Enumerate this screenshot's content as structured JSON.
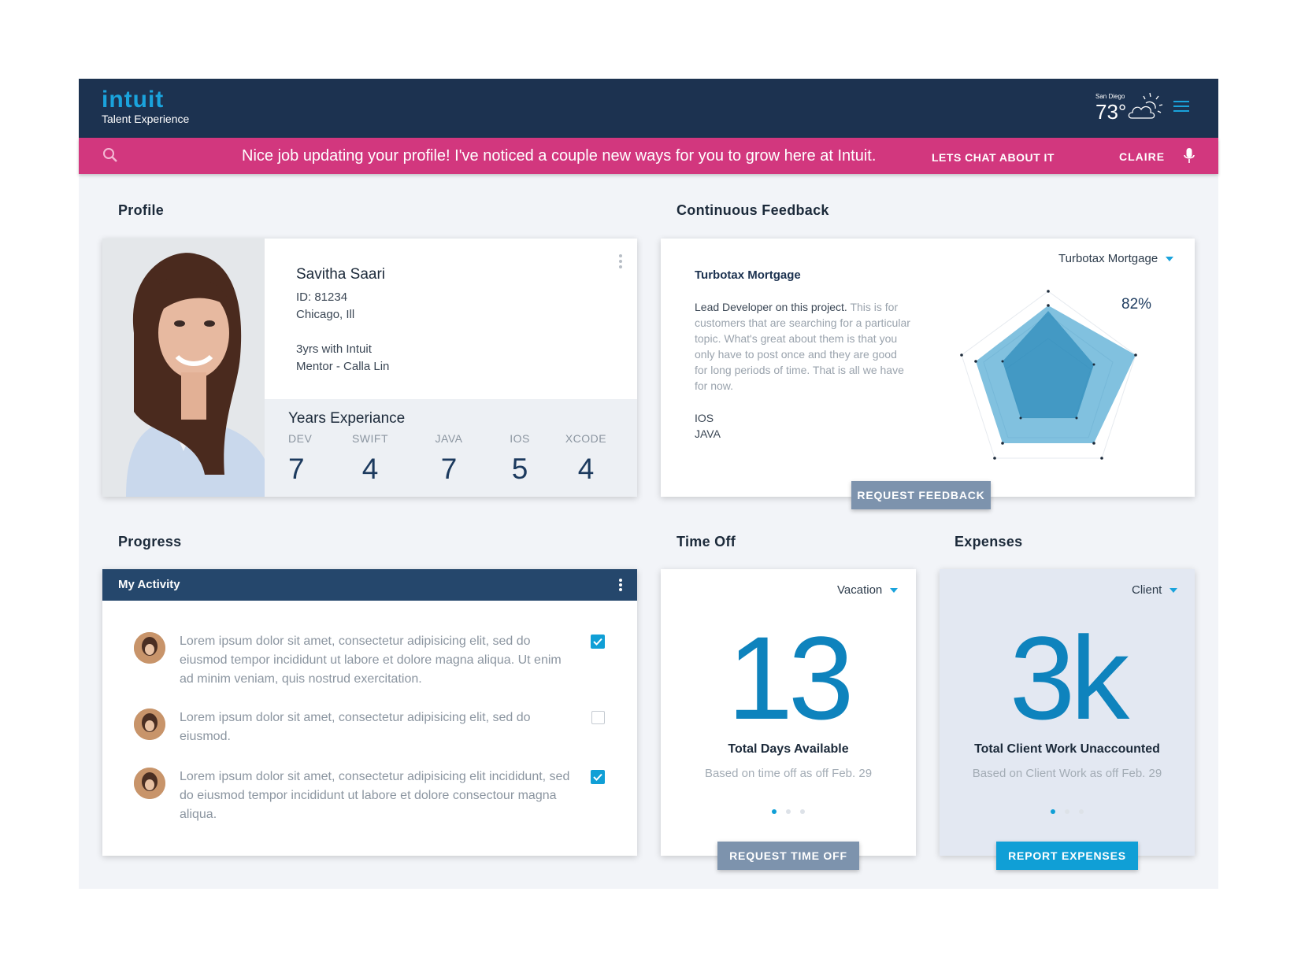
{
  "header": {
    "logo": "intuit",
    "subtitle": "Talent Experience",
    "weather": {
      "city": "San Diego",
      "temp": "73°",
      "icon": "cloudy-sun-icon"
    },
    "menu_icon": "hamburger-menu-icon"
  },
  "alert": {
    "message": "Nice job updating your profile! I've noticed a couple new ways for you to grow here at Intuit.",
    "cta": "LETS CHAT ABOUT IT",
    "assistant": "CLAIRE",
    "bg_color": "#d2377e"
  },
  "profile": {
    "section_title": "Profile",
    "name": "Savitha Saari",
    "id": "ID: 81234",
    "location": "Chicago, Ill",
    "tenure": "3yrs with Intuit",
    "mentor": "Mentor - Calla Lin",
    "experience_title": "Years Experiance",
    "experience": [
      {
        "label": "DEV",
        "value": "7"
      },
      {
        "label": "SWIFT",
        "value": "4"
      },
      {
        "label": "JAVA",
        "value": "7"
      },
      {
        "label": "IOS",
        "value": "5"
      },
      {
        "label": "XCODE",
        "value": "4"
      }
    ]
  },
  "feedback": {
    "section_title": "Continuous Feedback",
    "dropdown": "Turbotax Mortgage",
    "project": "Turbotax Mortgage",
    "lead": "Lead Developer on this project.",
    "description": "This is for customers that are searching for a particular topic. What's great about them is that you only have to post once and they are good for long periods of time. That is all we have for now.",
    "skills": [
      "IOS",
      "JAVA"
    ],
    "percent": "82%",
    "button": "REQUEST FEEDBACK",
    "radar_color": "#1a8ec4"
  },
  "progress": {
    "section_title": "Progress",
    "header": "My Activity",
    "items": [
      {
        "text": "Lorem ipsum dolor sit amet, consectetur adipisicing elit, sed do eiusmod tempor incididunt ut labore et dolore magna aliqua. Ut enim ad minim veniam, quis nostrud exercitation.",
        "checked": true
      },
      {
        "text": "Lorem ipsum dolor sit amet, consectetur adipisicing elit, sed do eiusmod.",
        "checked": false
      },
      {
        "text": "Lorem ipsum dolor sit amet, consectetur adipisicing elit incididunt, sed do eiusmod tempor incididunt ut labore et dolore consectour magna aliqua.",
        "checked": true
      }
    ]
  },
  "timeoff": {
    "section_title": "Time Off",
    "dropdown": "Vacation",
    "value": "13",
    "title": "Total Days Available",
    "subtitle": "Based on time off as off Feb. 29",
    "button": "REQUEST TIME OFF",
    "active_page": 1,
    "pages": 3
  },
  "expenses": {
    "section_title": "Expenses",
    "dropdown": "Client",
    "value": "3k",
    "title": "Total Client Work Unaccounted",
    "subtitle": "Based on Client Work as off Feb. 29",
    "button": "REPORT EXPENSES",
    "active_page": 1,
    "pages": 3
  }
}
